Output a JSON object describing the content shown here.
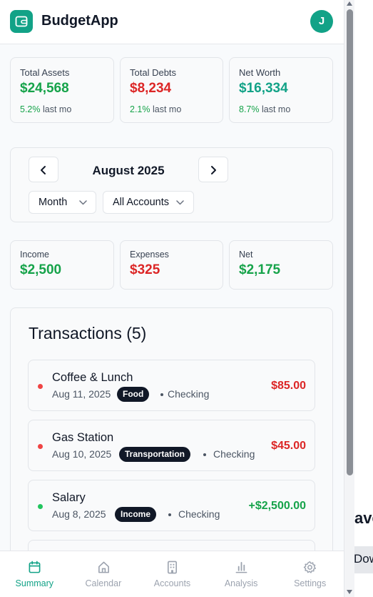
{
  "app": {
    "title": "BudgetApp",
    "user_initial": "J"
  },
  "summary": [
    {
      "label": "Total Assets",
      "value": "$24,568",
      "change": "5.2%",
      "change_suffix": "last mo",
      "color": "#16a34a"
    },
    {
      "label": "Total Debts",
      "value": "$8,234",
      "change": "2.1%",
      "change_suffix": "last mo",
      "color": "#dc2626"
    },
    {
      "label": "Net Worth",
      "value": "$16,334",
      "change": "8.7%",
      "change_suffix": "last mo",
      "color": "#12a287"
    }
  ],
  "period": {
    "title": "August 2025",
    "range_select": "Month",
    "account_select": "All Accounts"
  },
  "totals": [
    {
      "label": "Income",
      "value": "$2,500",
      "color": "#16a34a"
    },
    {
      "label": "Expenses",
      "value": "$325",
      "color": "#dc2626"
    },
    {
      "label": "Net",
      "value": "$2,175",
      "color": "#16a34a"
    }
  ],
  "transactions": {
    "title": "Transactions (5)",
    "items": [
      {
        "name": "Coffee & Lunch",
        "date": "Aug 11, 2025",
        "category": "Food",
        "account": "Checking",
        "amount": "$85.00",
        "type": "expense"
      },
      {
        "name": "Gas Station",
        "date": "Aug 10, 2025",
        "category": "Transportation",
        "account": "Checking",
        "amount": "$45.00",
        "type": "expense"
      },
      {
        "name": "Salary",
        "date": "Aug 8, 2025",
        "category": "Income",
        "account": "Checking",
        "amount": "+$2,500.00",
        "type": "income"
      }
    ]
  },
  "bottom_nav": [
    {
      "label": "Summary",
      "icon": "calendar-icon",
      "active": true
    },
    {
      "label": "Calendar",
      "icon": "home-icon",
      "active": false
    },
    {
      "label": "Accounts",
      "icon": "building-icon",
      "active": false
    },
    {
      "label": "Analysis",
      "icon": "bar-chart-icon",
      "active": false
    },
    {
      "label": "Settings",
      "icon": "gear-icon",
      "active": false
    }
  ],
  "backdrop": {
    "heading_fragment": "ave",
    "bar_fragment": "Dow"
  },
  "colors": {
    "accent": "#12a287",
    "income": "#16a34a",
    "expense": "#dc2626"
  }
}
